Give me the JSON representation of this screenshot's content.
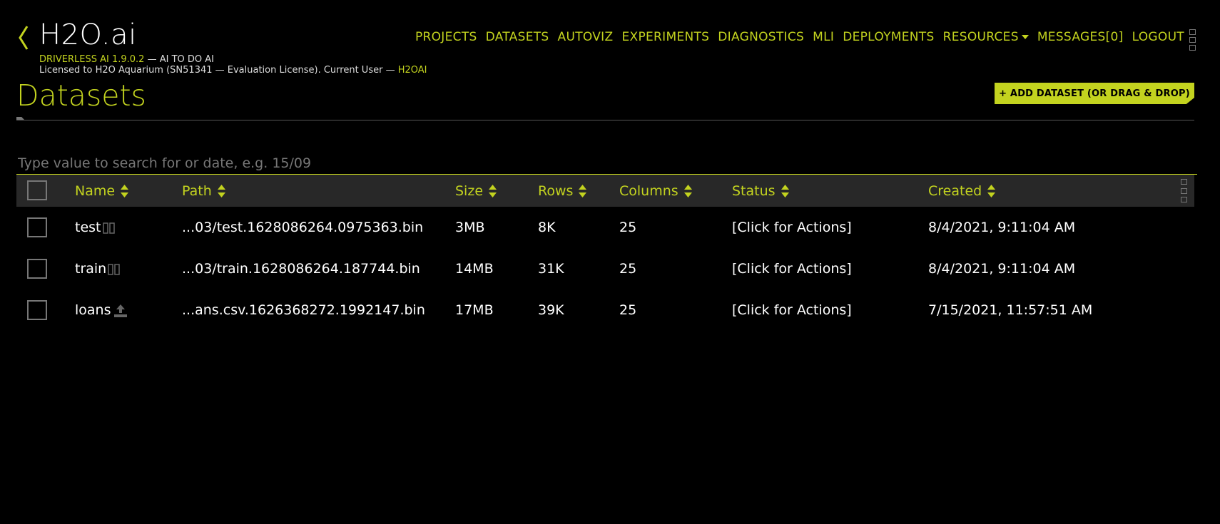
{
  "header": {
    "brand": "H2O.ai",
    "product": "DRIVERLESS AI 1.9.0.2",
    "tagline": " — AI TO DO AI",
    "license_text": "Licensed to H2O Aquarium (SN51341 — Evaluation License). Current User — ",
    "current_user": "H2OAI"
  },
  "nav": {
    "items": [
      "PROJECTS",
      "DATASETS",
      "AUTOVIZ",
      "EXPERIMENTS",
      "DIAGNOSTICS",
      "MLI",
      "DEPLOYMENTS",
      "RESOURCES",
      "MESSAGES[0]",
      "LOGOUT"
    ]
  },
  "page": {
    "title": "Datasets",
    "add_button": "+ ADD DATASET (OR DRAG & DROP)"
  },
  "search": {
    "placeholder": "Type value to search for or date, e.g. 15/09",
    "value": ""
  },
  "table": {
    "columns": [
      "Name",
      "Path",
      "Size",
      "Rows",
      "Columns",
      "Status",
      "Created"
    ],
    "rows": [
      {
        "name": "test",
        "icon": "split-icon",
        "path": "...03/test.1628086264.0975363.bin",
        "size": "3MB",
        "rows": "8K",
        "columns": "25",
        "status": "[Click for Actions]",
        "created": "8/4/2021, 9:11:04 AM"
      },
      {
        "name": "train",
        "icon": "split-icon",
        "path": "...03/train.1628086264.187744.bin",
        "size": "14MB",
        "rows": "31K",
        "columns": "25",
        "status": "[Click for Actions]",
        "created": "8/4/2021, 9:11:04 AM"
      },
      {
        "name": "loans",
        "icon": "upload-icon",
        "path": "...ans.csv.1626368272.1992147.bin",
        "size": "17MB",
        "rows": "39K",
        "columns": "25",
        "status": "[Click for Actions]",
        "created": "7/15/2021, 11:57:51 AM"
      }
    ]
  },
  "colors": {
    "accent": "#c3d31f",
    "background": "#000000",
    "header_row": "#282828"
  }
}
